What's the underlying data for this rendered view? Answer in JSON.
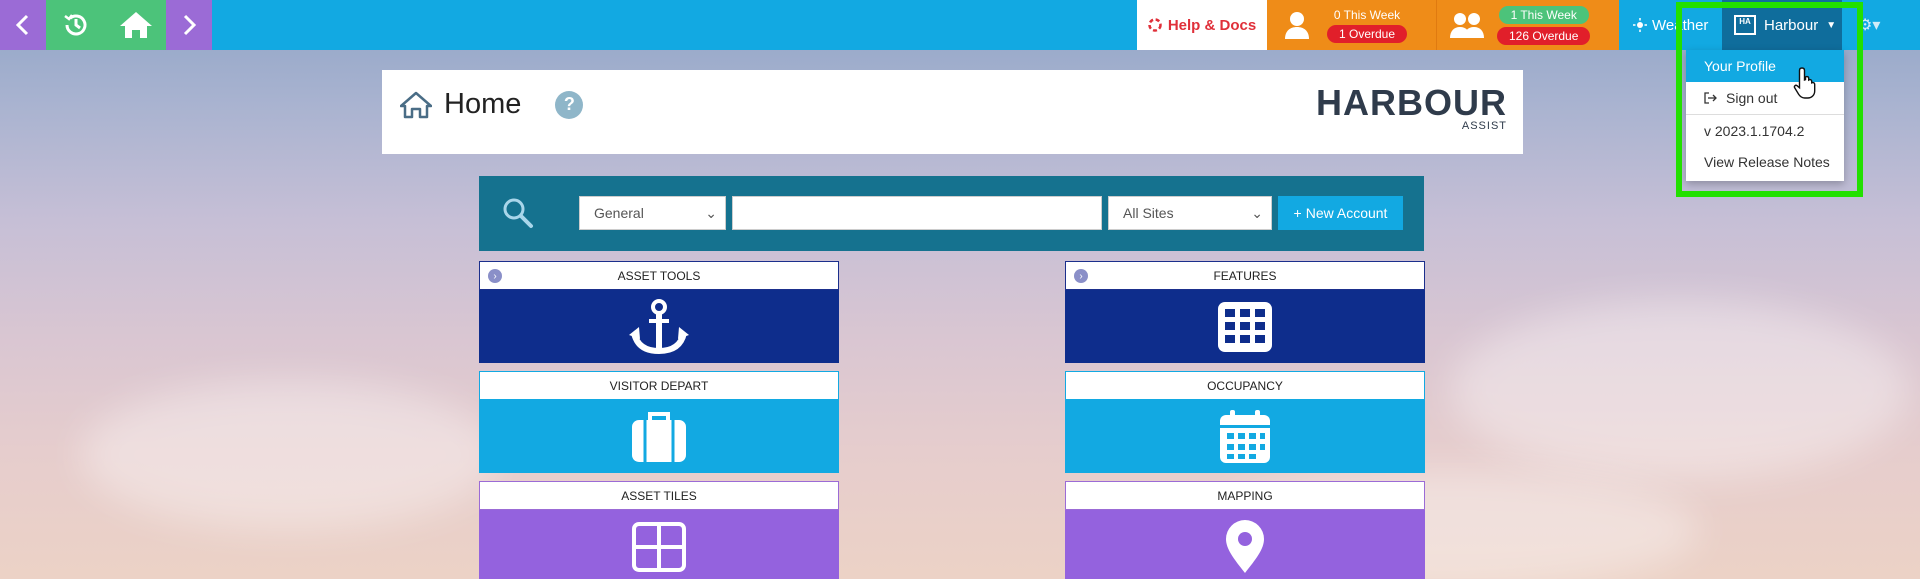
{
  "topbar": {
    "help_label": "Help & Docs",
    "my_tasks": {
      "this_week": "0 This Week",
      "overdue": "1 Overdue"
    },
    "team_tasks": {
      "this_week": "1 This Week",
      "overdue": "126 Overdue"
    },
    "weather_label": "Weather",
    "account_label": "Harbour",
    "account_badge": "HA"
  },
  "dropdown": {
    "items": [
      "Your Profile",
      "Sign out",
      "v 2023.1.1704.2",
      "View Release Notes"
    ]
  },
  "header": {
    "title": "Home",
    "help_glyph": "?",
    "logo_main": "HARBOUR",
    "logo_sub": "ASSIST"
  },
  "search": {
    "type_value": "General",
    "query_value": "",
    "site_value": "All Sites",
    "new_account_label": "New Account"
  },
  "tiles": [
    {
      "label": "ASSET TOOLS",
      "icon": "anchor-icon"
    },
    {
      "label": "FEATURES",
      "icon": "grid-icon"
    },
    {
      "label": "VISITOR DEPART",
      "icon": "suitcase-icon"
    },
    {
      "label": "OCCUPANCY",
      "icon": "calendar-icon"
    },
    {
      "label": "ASSET TILES",
      "icon": "tiles-icon"
    },
    {
      "label": "MAPPING",
      "icon": "map-pin-icon"
    }
  ],
  "colors": {
    "topbar": "#12a9e2",
    "nav_purple": "#9b6bd6",
    "nav_green": "#4cc37a",
    "tasks_orange": "#ef8c18",
    "tile_dark": "#0e2d8c",
    "tile_light": "#12a9e2",
    "tile_purple": "#9462de",
    "highlight": "#22e000"
  }
}
